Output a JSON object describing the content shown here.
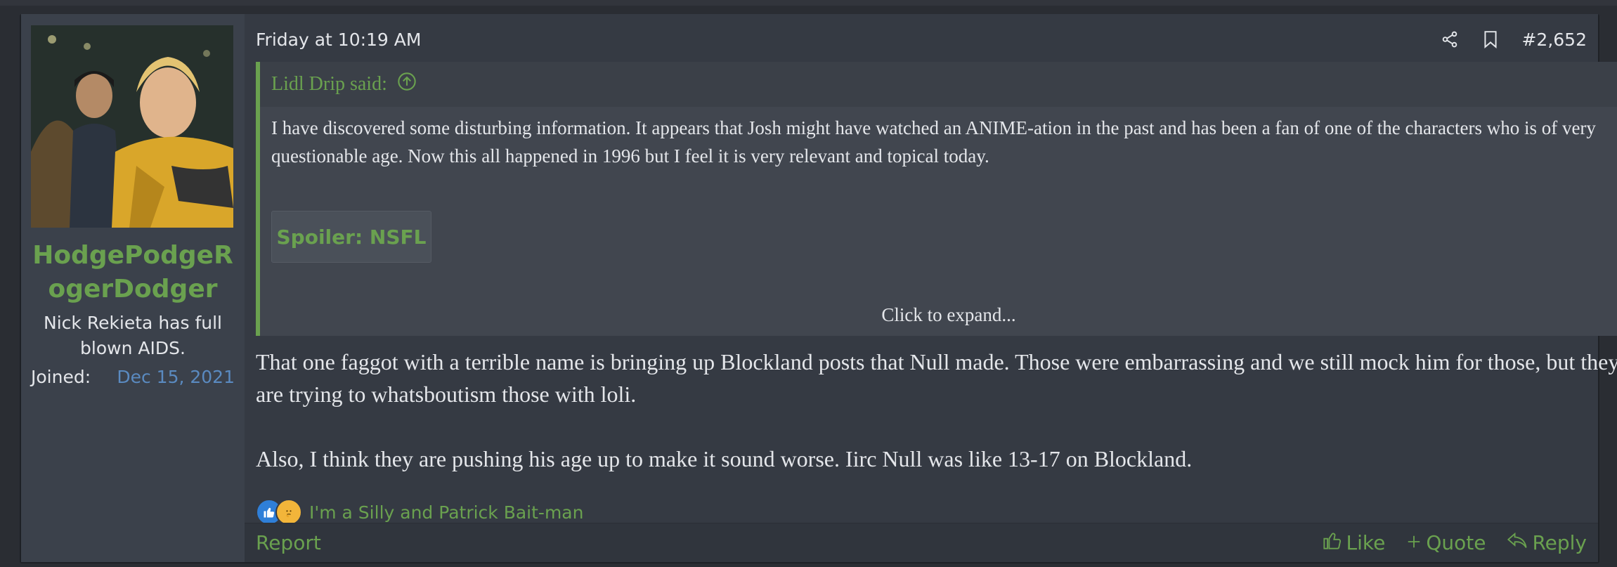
{
  "user": {
    "name": "HodgePodgeRogerDodger",
    "title": "Nick Rekieta has full blown AIDS.",
    "joined_label": "Joined:",
    "joined_value": "Dec 15, 2021"
  },
  "post": {
    "date": "Friday at 10:19 AM",
    "number": "#2,652",
    "quote": {
      "author": "Lidl Drip said:",
      "text": "I have discovered some disturbing information. It appears that Josh might have watched an ANIME-ation in the past and has been a fan of one of the characters who is of very questionable age. Now this all happened in 1996 but I feel it is very relevant and topical today.",
      "spoiler_label": "Spoiler: NSFL",
      "expand_label": "Click to expand..."
    },
    "message": [
      "That one faggot with a terrible name is bringing up Blockland posts that Null made. Those were embarrassing and we still mock him for those, but they are trying to whatsboutism those with loli.",
      "Also, I think they are pushing his age up to make it sound worse. Iirc Null was like 13-17 on Blockland."
    ],
    "reactions_text": "I'm a Silly and Patrick Bait-man"
  },
  "footer": {
    "report": "Report",
    "like": "Like",
    "quote": "Quote",
    "reply": "Reply"
  },
  "icons": {
    "share": "share-icon",
    "bookmark": "bookmark-icon",
    "quote_up": "arrow-up-circle-icon",
    "like": "thumbs-up-icon",
    "plus": "plus-icon",
    "reply": "reply-icon"
  },
  "colors": {
    "accent": "#6aa14f",
    "link_blue": "#5a8ac0",
    "background": "#353a43"
  }
}
